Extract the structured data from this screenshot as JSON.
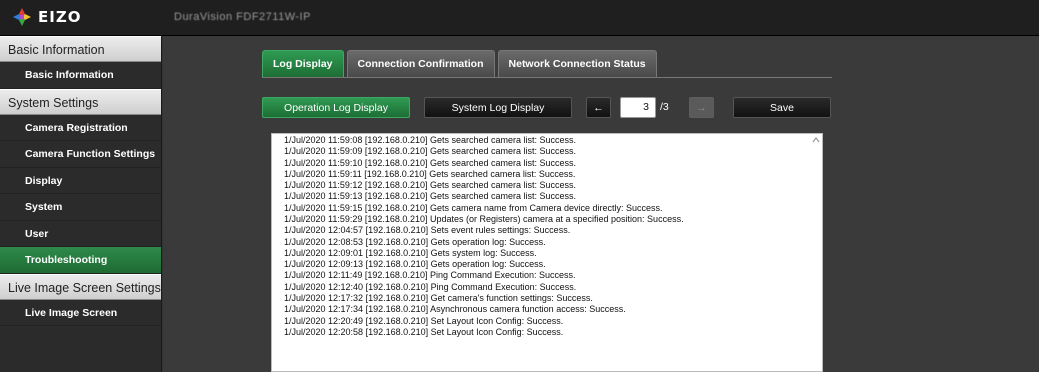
{
  "brand": {
    "logo_text": "EIZO",
    "device_name": "DuraVision FDF2711W-IP"
  },
  "sidebar": {
    "sections": [
      {
        "title": "Basic Information",
        "items": [
          {
            "label": "Basic Information",
            "active": false
          }
        ]
      },
      {
        "title": "System Settings",
        "items": [
          {
            "label": "Camera Registration",
            "active": false
          },
          {
            "label": "Camera Function Settings",
            "active": false
          },
          {
            "label": "Display",
            "active": false
          },
          {
            "label": "System",
            "active": false
          },
          {
            "label": "User",
            "active": false
          },
          {
            "label": "Troubleshooting",
            "active": true
          }
        ]
      },
      {
        "title": "Live Image Screen Settings",
        "items": [
          {
            "label": "Live Image Screen",
            "active": false
          }
        ]
      }
    ]
  },
  "tabs": [
    {
      "label": "Log Display",
      "active": true
    },
    {
      "label": "Connection Confirmation",
      "active": false
    },
    {
      "label": "Network Connection Status",
      "active": false
    }
  ],
  "controls": {
    "operation_log_label": "Operation Log Display",
    "system_log_label": "System Log Display",
    "prev_icon": "←",
    "next_icon": "→",
    "page_current": "3",
    "page_total": "/3",
    "save_label": "Save"
  },
  "log_lines": [
    "1/Jul/2020 11:59:08  [192.168.0.210] Gets searched camera list: Success.",
    "1/Jul/2020 11:59:09  [192.168.0.210] Gets searched camera list: Success.",
    "1/Jul/2020 11:59:10  [192.168.0.210] Gets searched camera list: Success.",
    "1/Jul/2020 11:59:11  [192.168.0.210] Gets searched camera list: Success.",
    "1/Jul/2020 11:59:12  [192.168.0.210] Gets searched camera list: Success.",
    "1/Jul/2020 11:59:13  [192.168.0.210] Gets searched camera list: Success.",
    "1/Jul/2020 11:59:15  [192.168.0.210] Gets camera name from Camera device directly: Success.",
    "1/Jul/2020 11:59:29  [192.168.0.210] Updates (or Registers) camera at a specified position: Success.",
    "1/Jul/2020 12:04:57  [192.168.0.210] Sets event rules settings: Success.",
    "1/Jul/2020 12:08:53  [192.168.0.210] Gets operation log: Success.",
    "1/Jul/2020 12:09:01  [192.168.0.210] Gets system log: Success.",
    "1/Jul/2020 12:09:13  [192.168.0.210] Gets operation log: Success.",
    "1/Jul/2020 12:11:49  [192.168.0.210] Ping Command Execution: Success.",
    "1/Jul/2020 12:12:40  [192.168.0.210] Ping Command Execution: Success.",
    "1/Jul/2020 12:17:32  [192.168.0.210] Get camera's function settings: Success.",
    "1/Jul/2020 12:17:34  [192.168.0.210] Asynchronous camera function access: Success.",
    "1/Jul/2020 12:20:49  [192.168.0.210] Set Layout Icon Config: Success.",
    "1/Jul/2020 12:20:58  [192.168.0.210] Set Layout Icon Config: Success."
  ]
}
